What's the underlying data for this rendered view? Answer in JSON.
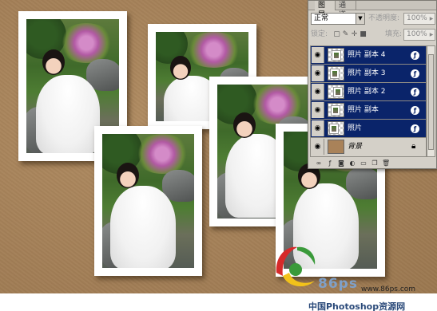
{
  "panel": {
    "tabs": [
      "图层",
      "通道"
    ],
    "blend_mode": "正常",
    "opacity_label": "不透明度:",
    "opacity_value": "100%",
    "lock_label": "锁定:",
    "fill_label": "填充:",
    "fill_value": "100%",
    "layers": [
      {
        "name": "照片 副本 4",
        "selected": true
      },
      {
        "name": "照片 副本 3",
        "selected": true
      },
      {
        "name": "照片 副本 2",
        "selected": true
      },
      {
        "name": "照片 副本",
        "selected": true
      },
      {
        "name": "照片",
        "selected": true
      },
      {
        "name": "背景",
        "selected": false
      }
    ]
  },
  "watermark": {
    "number": "86ps",
    "url": "www.86ps.com",
    "site_name": "中国Photoshop资源网"
  },
  "colors": {
    "selection": "#0a246a",
    "panel_bg": "#d4d0c8",
    "paper": "#a27e56"
  }
}
